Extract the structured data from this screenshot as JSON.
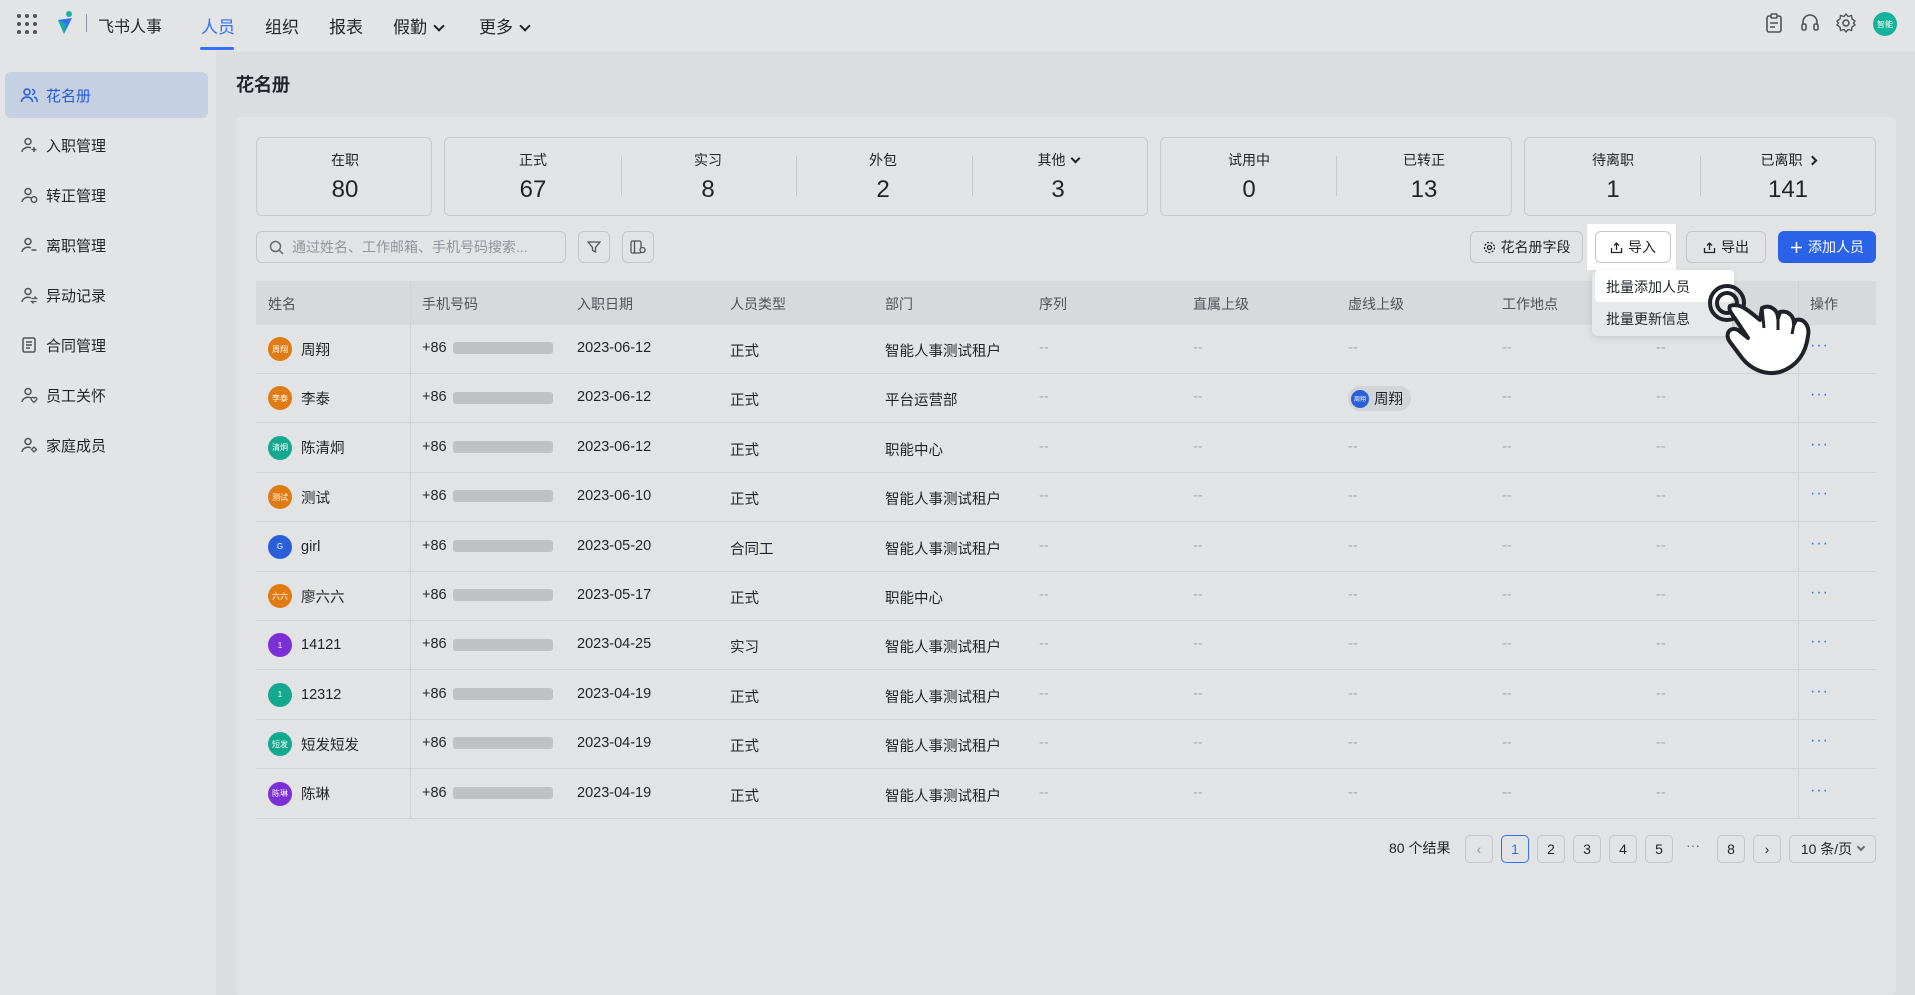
{
  "app": {
    "name": "飞书人事"
  },
  "nav": {
    "items": [
      {
        "label": "人员"
      },
      {
        "label": "组织"
      },
      {
        "label": "报表"
      },
      {
        "label": "假勤"
      },
      {
        "label": "更多"
      }
    ],
    "active": "人员",
    "avatar_text": "智能"
  },
  "sidebar": {
    "items": [
      {
        "label": "花名册",
        "icon": "people-icon"
      },
      {
        "label": "入职管理",
        "icon": "user-add-icon"
      },
      {
        "label": "转正管理",
        "icon": "user-check-icon"
      },
      {
        "label": "离职管理",
        "icon": "user-minus-icon"
      },
      {
        "label": "异动记录",
        "icon": "user-transfer-icon"
      },
      {
        "label": "合同管理",
        "icon": "document-icon"
      },
      {
        "label": "员工关怀",
        "icon": "user-heart-icon"
      },
      {
        "label": "家庭成员",
        "icon": "family-icon"
      }
    ]
  },
  "page": {
    "title": "花名册"
  },
  "stats": {
    "active": {
      "label": "在职",
      "value": "80"
    },
    "regular": {
      "label": "正式",
      "value": "67"
    },
    "intern": {
      "label": "实习",
      "value": "8"
    },
    "outsource": {
      "label": "外包",
      "value": "2"
    },
    "other": {
      "label": "其他",
      "value": "3"
    },
    "probation": {
      "label": "试用中",
      "value": "0"
    },
    "converted": {
      "label": "已转正",
      "value": "13"
    },
    "pending_leave": {
      "label": "待离职",
      "value": "1"
    },
    "left": {
      "label": "已离职",
      "value": "141"
    }
  },
  "toolbar": {
    "search_placeholder": "通过姓名、工作邮箱、手机号码搜索...",
    "fields_label": "花名册字段",
    "import_label": "导入",
    "export_label": "导出",
    "add_label": "添加人员"
  },
  "import_menu": {
    "items": [
      "批量添加人员",
      "批量更新信息"
    ]
  },
  "table": {
    "columns": [
      "姓名",
      "手机号码",
      "入职日期",
      "人员类型",
      "部门",
      "序列",
      "直属上级",
      "虚线上级",
      "工作地点",
      "",
      "操作"
    ],
    "rows": [
      {
        "name": "周翔",
        "avatar": "周翔",
        "avatar_color": "#e07a12",
        "phone_prefix": "+86",
        "date": "2023-06-12",
        "type": "正式",
        "dept": "智能人事测试租户",
        "seq": "--",
        "manager": "--",
        "dotted": "--",
        "location": "--",
        "extra": "--"
      },
      {
        "name": "李泰",
        "avatar": "李泰",
        "avatar_color": "#e07a12",
        "phone_prefix": "+86",
        "date": "2023-06-12",
        "type": "正式",
        "dept": "平台运营部",
        "seq": "--",
        "manager": "--",
        "dotted": "周翔",
        "location": "--",
        "extra": "--"
      },
      {
        "name": "陈清炯",
        "avatar": "清炯",
        "avatar_color": "#14a98f",
        "phone_prefix": "+86",
        "date": "2023-06-12",
        "type": "正式",
        "dept": "职能中心",
        "seq": "--",
        "manager": "--",
        "dotted": "--",
        "location": "--",
        "extra": "--"
      },
      {
        "name": "测试",
        "avatar": "测试",
        "avatar_color": "#e07a12",
        "phone_prefix": "+86",
        "date": "2023-06-10",
        "type": "正式",
        "dept": "智能人事测试租户",
        "seq": "--",
        "manager": "--",
        "dotted": "--",
        "location": "--",
        "extra": "--"
      },
      {
        "name": "girl",
        "avatar": "G",
        "avatar_color": "#2b5fd9",
        "phone_prefix": "+86",
        "date": "2023-05-20",
        "type": "合同工",
        "dept": "智能人事测试租户",
        "seq": "--",
        "manager": "--",
        "dotted": "--",
        "location": "--",
        "extra": "--"
      },
      {
        "name": "廖六六",
        "avatar": "六六",
        "avatar_color": "#e07a12",
        "phone_prefix": "+86",
        "date": "2023-05-17",
        "type": "正式",
        "dept": "职能中心",
        "seq": "--",
        "manager": "--",
        "dotted": "--",
        "location": "--",
        "extra": "--"
      },
      {
        "name": "14121",
        "avatar": "1",
        "avatar_color": "#7b2fd6",
        "phone_prefix": "+86",
        "date": "2023-04-25",
        "type": "实习",
        "dept": "智能人事测试租户",
        "seq": "--",
        "manager": "--",
        "dotted": "--",
        "location": "--",
        "extra": "--"
      },
      {
        "name": "12312",
        "avatar": "1",
        "avatar_color": "#14a98f",
        "phone_prefix": "+86",
        "date": "2023-04-19",
        "type": "正式",
        "dept": "智能人事测试租户",
        "seq": "--",
        "manager": "--",
        "dotted": "--",
        "location": "--",
        "extra": "--"
      },
      {
        "name": "短发短发",
        "avatar": "短发",
        "avatar_color": "#14a98f",
        "phone_prefix": "+86",
        "date": "2023-04-19",
        "type": "正式",
        "dept": "智能人事测试租户",
        "seq": "--",
        "manager": "--",
        "dotted": "--",
        "location": "--",
        "extra": "--"
      },
      {
        "name": "陈琳",
        "avatar": "陈琳",
        "avatar_color": "#7b2fd6",
        "phone_prefix": "+86",
        "date": "2023-04-19",
        "type": "正式",
        "dept": "智能人事测试租户",
        "seq": "--",
        "manager": "--",
        "dotted": "--",
        "location": "--",
        "extra": "--"
      }
    ]
  },
  "pagination": {
    "results": "80 个结果",
    "pages": [
      "1",
      "2",
      "3",
      "4",
      "5"
    ],
    "ellipsis": "···",
    "last": "8",
    "current": "1",
    "per_page": "10 条/页"
  },
  "colors": {
    "accent": "#3370ff",
    "primary_button": "#2b63e8"
  }
}
